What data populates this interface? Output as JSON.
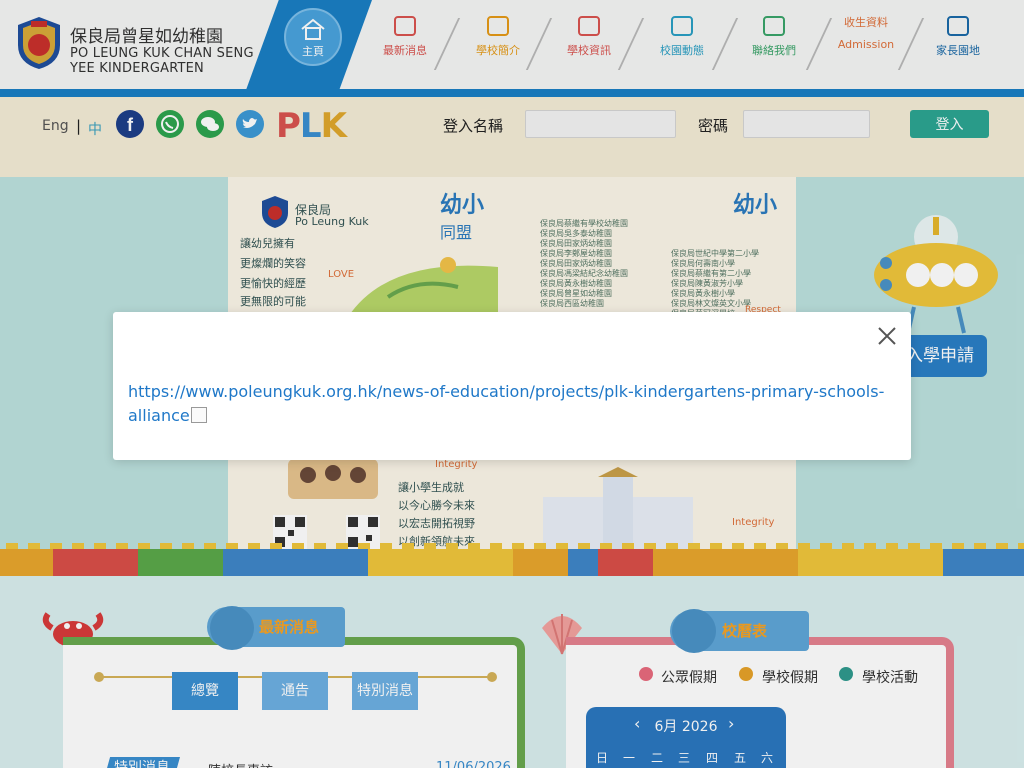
{
  "header": {
    "school_name_zh": "保良局曾星如幼稚園",
    "school_name_en_line1": "PO LEUNG KUK CHAN SENG",
    "school_name_en_line2": "YEE KINDERGARTEN",
    "home_label": "主頁",
    "nav": [
      {
        "label": "最新消息",
        "icon": "newspaper-icon",
        "color": "#d9534f"
      },
      {
        "label": "學校簡介",
        "icon": "school-building-icon",
        "color": "#e59a17"
      },
      {
        "label": "學校資訊",
        "icon": "megaphone-icon",
        "color": "#d9534f"
      },
      {
        "label": "校園動態",
        "icon": "photo-icon",
        "color": "#2a9fc4"
      },
      {
        "label": "聯絡我們",
        "icon": "handshake-icon",
        "color": "#3aa46a"
      },
      {
        "label": "收生資料",
        "label_en": "Admission",
        "icon": "sparkle-icon",
        "color": "#e0713b"
      },
      {
        "label": "家長園地",
        "icon": "heart-icon",
        "color": "#1a6aa8"
      }
    ]
  },
  "login": {
    "lang_en": "Eng",
    "lang_sep": "|",
    "lang_zh": "中",
    "social_icons": [
      "facebook-icon",
      "whatsapp-icon",
      "wechat-icon",
      "twitter-icon"
    ],
    "plk_logo": "PLK",
    "username_label": "登入名稱",
    "username_value": "",
    "password_label": "密碼",
    "password_value": "",
    "login_button": "登入"
  },
  "hero": {
    "poster_org_zh": "保良局",
    "poster_org_en": "Po Leung Kuk",
    "poster_heading_left": "幼小",
    "poster_heading_sub": "同盟",
    "poster_heading_right": "幼小",
    "poster_lines_left": [
      "讓幼兒擁有",
      "更燦爛的笑容",
      "更愉快的經歷",
      "更無限的可能"
    ],
    "poster_lines_bottom": [
      "讓小學生成就",
      "以今心勝今未來",
      "以宏志開拓視野",
      "以創新領航未來"
    ],
    "poster_list_mid": "保良局蔡繼有學校幼稚園\n保良局吳多泰幼稚園\n保良局田家炳幼稚園\n保良局李鄭屋幼稚園\n保良局田家炳幼稚園\n保良局馮梁結紀念幼稚園\n保良局黃永樹幼稚園\n保良局曾星如幼稚園\n保良局西區幼稚園",
    "poster_list_right": "保良局世紀中學第二小學\n保良局何壽南小學\n保良局蔡繼有第二小學\n保良局陳黃淑芳小學\n保良局黃永樹小學\n保良局林文燦英文小學\n保良局蔡冠深學校\n保良局建造商會學校",
    "poster_tags": [
      "LOVE",
      "Integrity",
      "Integrity",
      "Respect"
    ],
    "apply_button": "入學申請",
    "block_colors": [
      "#e8a62d",
      "#d94f49",
      "#5ba84a",
      "#3f86c8",
      "#f0c63c",
      "#e8a62d",
      "#3f86c8",
      "#d94f49",
      "#e8a62d",
      "#f0c63c",
      "#3f86c8"
    ]
  },
  "news": {
    "title": "最新消息",
    "tabs": [
      "總覽",
      "通告",
      "特別消息"
    ],
    "tag": "特別消息",
    "item_title": "陳校長專訪",
    "item_date": "11/06/2026"
  },
  "calendar": {
    "title": "校曆表",
    "legend": [
      {
        "label": "公眾假期",
        "color": "#e86b7e"
      },
      {
        "label": "學校假期",
        "color": "#e6a229"
      },
      {
        "label": "學校活動",
        "color": "#2f9a8e"
      }
    ],
    "month_label": "6月 2026",
    "prev": "‹",
    "next": "›",
    "weekdays": [
      "日",
      "一",
      "二",
      "三",
      "四",
      "五",
      "六"
    ]
  },
  "modal": {
    "link_text": "https://www.poleungkuk.org.hk/news-of-education/projects/plk-kindergartens-primary-schools-alliance",
    "close_icon": "close-icon"
  }
}
